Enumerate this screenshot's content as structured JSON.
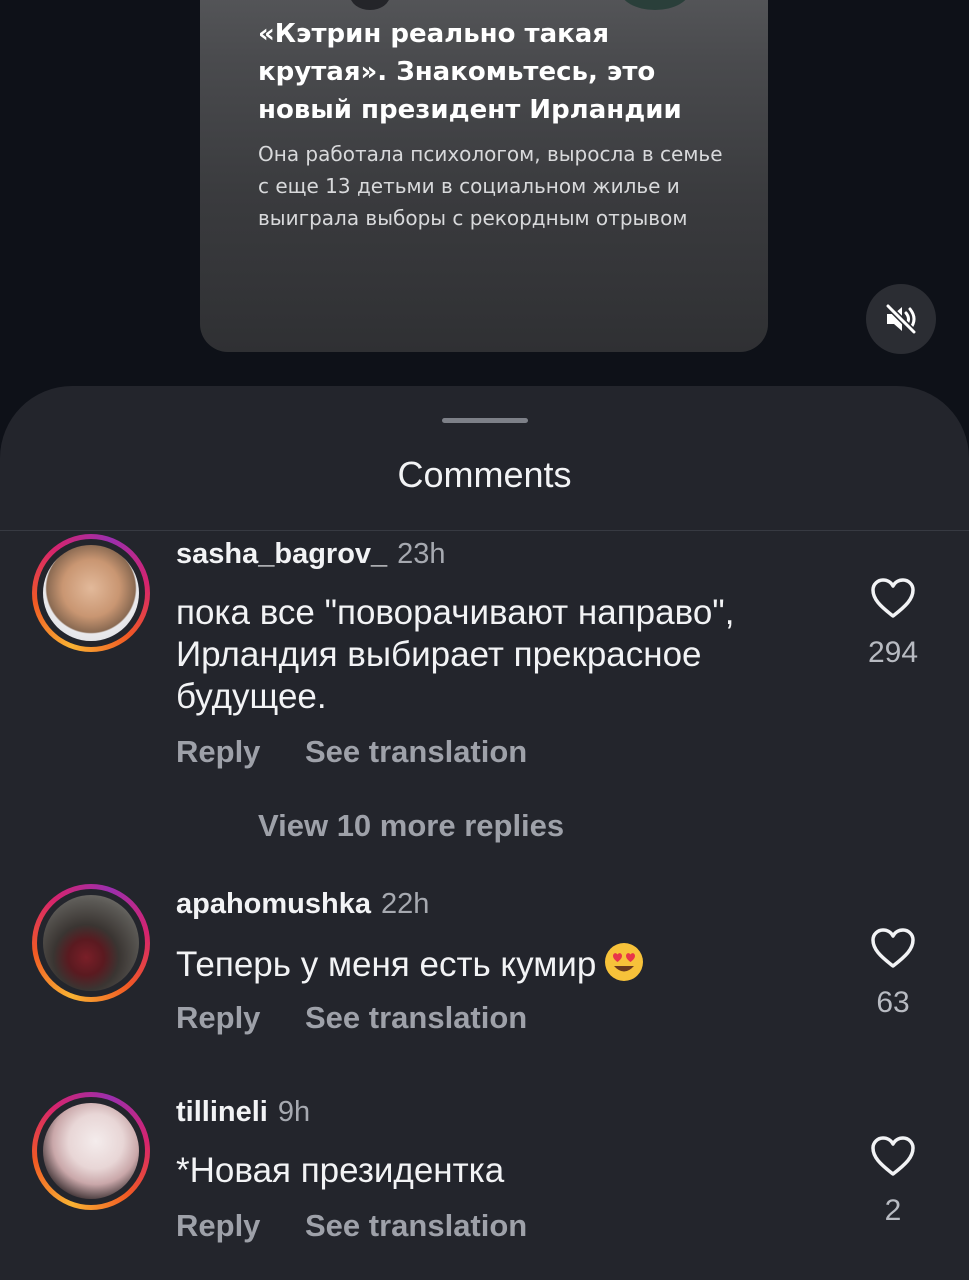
{
  "post": {
    "title": "«Кэтрин реально такая крутая». Знакомьтесь, это новый президент Ирландии",
    "subtitle": "Она работала психологом, выросла в семье с еще 13 детьми в социальном жилье и выиграла выборы с рекордным отрывом",
    "mute_icon": "speaker-muted-icon"
  },
  "sheet": {
    "title": "Comments",
    "view_more_replies": "View 10 more replies"
  },
  "comments": [
    {
      "username": "sasha_bagrov_",
      "time": "23h",
      "text": "пока все \"поворачивают направо\", Ирландия выбирает прекрасное будущее.",
      "reply": "Reply",
      "see_translation": "See translation",
      "likes": "294"
    },
    {
      "username": "apahomushka",
      "time": "22h",
      "text": "Теперь у меня есть кумир",
      "emoji": "heart-eyes-emoji",
      "reply": "Reply",
      "see_translation": "See translation",
      "likes": "63"
    },
    {
      "username": "tillineli",
      "time": "9h",
      "text": "*Новая президентка",
      "reply": "Reply",
      "see_translation": "See translation",
      "likes": "2"
    }
  ],
  "colors": {
    "background": "#0e1118",
    "sheet": "#23252c",
    "text": "#f2f3f5",
    "muted": "#9ea1a9"
  }
}
